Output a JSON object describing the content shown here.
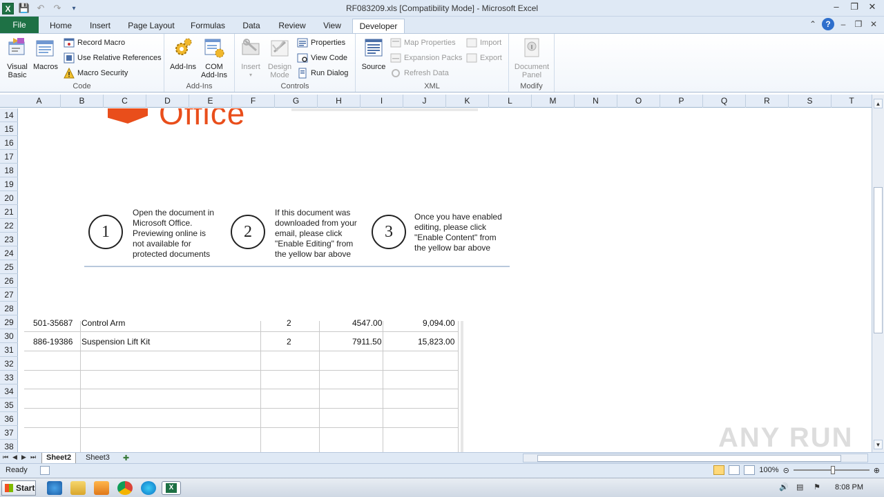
{
  "window": {
    "title": "RF083209.xls  [Compatibility Mode] - Microsoft Excel",
    "app_icon": "excel-icon"
  },
  "tabs": [
    "File",
    "Home",
    "Insert",
    "Page Layout",
    "Formulas",
    "Data",
    "Review",
    "View",
    "Developer"
  ],
  "active_tab": "Developer",
  "ribbon": {
    "code": {
      "label": "Code",
      "visual_basic": "Visual Basic",
      "macros": "Macros",
      "record_macro": "Record Macro",
      "use_relative": "Use Relative References",
      "macro_security": "Macro Security"
    },
    "addins": {
      "label": "Add-Ins",
      "addins": "Add-Ins",
      "com_addins": "COM Add-Ins"
    },
    "controls": {
      "label": "Controls",
      "insert": "Insert",
      "design_mode": "Design Mode",
      "properties": "Properties",
      "view_code": "View Code",
      "run_dialog": "Run Dialog"
    },
    "xml": {
      "label": "XML",
      "source": "Source",
      "map_properties": "Map Properties",
      "expansion_packs": "Expansion Packs",
      "refresh_data": "Refresh Data",
      "import": "Import",
      "export": "Export"
    },
    "modify": {
      "label": "Modify",
      "document_panel": "Document Panel"
    }
  },
  "columns": [
    "A",
    "B",
    "C",
    "D",
    "E",
    "F",
    "G",
    "H",
    "I",
    "J",
    "K",
    "L",
    "M",
    "N",
    "O",
    "P",
    "Q",
    "R",
    "S",
    "T"
  ],
  "rows": [
    "14",
    "15",
    "16",
    "17",
    "18",
    "19",
    "20",
    "21",
    "22",
    "23",
    "24",
    "25",
    "26",
    "27",
    "28",
    "29",
    "30",
    "31",
    "32",
    "33",
    "34",
    "35",
    "36",
    "37",
    "38"
  ],
  "banner": {
    "office_text": "Office",
    "steps": [
      {
        "num": "1",
        "text": "Open the document in\nMicrosoft Office.\nPreviewing online is\nnot available for\nprotected documents"
      },
      {
        "num": "2",
        "text": "If this document was\ndownloaded from your\nemail, please click\n\"Enable Editing\" from\nthe yellow bar above"
      },
      {
        "num": "3",
        "text": "Once you have enabled\nediting, please click\n\"Enable Content\" from\nthe yellow bar above"
      }
    ]
  },
  "table_rows": [
    {
      "part": "501-35687",
      "desc": "Control Arm",
      "qty": "2",
      "price": "4547.00",
      "total": "9,094.00"
    },
    {
      "part": "886-19386",
      "desc": "Suspension Lift Kit",
      "qty": "2",
      "price": "7911.50",
      "total": "15,823.00"
    }
  ],
  "sheets": [
    "Sheet2",
    "Sheet3"
  ],
  "active_sheet": "Sheet2",
  "status": {
    "ready": "Ready",
    "zoom": "100%"
  },
  "taskbar": {
    "start": "Start",
    "clock": "8:08 PM"
  },
  "watermark": "ANY RUN"
}
